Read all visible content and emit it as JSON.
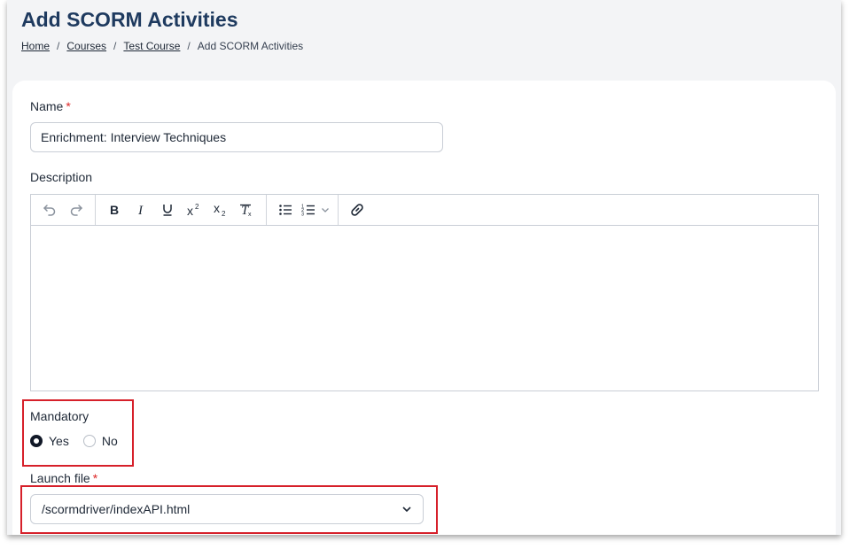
{
  "header": {
    "title": "Add SCORM Activities",
    "breadcrumb": [
      "Home",
      "Courses",
      "Test Course",
      "Add SCORM Activities"
    ]
  },
  "form": {
    "name": {
      "label": "Name",
      "required_mark": "*",
      "value": "Enrichment: Interview Techniques"
    },
    "description": {
      "label": "Description",
      "toolbar": [
        "undo-icon",
        "redo-icon",
        "bold-icon",
        "italic-icon",
        "underline-icon",
        "superscript-icon",
        "subscript-icon",
        "clear-formatting-icon",
        "bullet-list-icon",
        "numbered-list-icon",
        "chevron-down-icon",
        "link-icon"
      ],
      "value": ""
    },
    "mandatory": {
      "label": "Mandatory",
      "options": [
        "Yes",
        "No"
      ],
      "selected": "Yes"
    },
    "launch_file": {
      "label": "Launch file",
      "required_mark": "*",
      "value": "/scormdriver/indexAPI.html"
    }
  },
  "colors": {
    "title": "#1e3a5f",
    "required": "#dc2626",
    "highlight": "#d6202a"
  }
}
